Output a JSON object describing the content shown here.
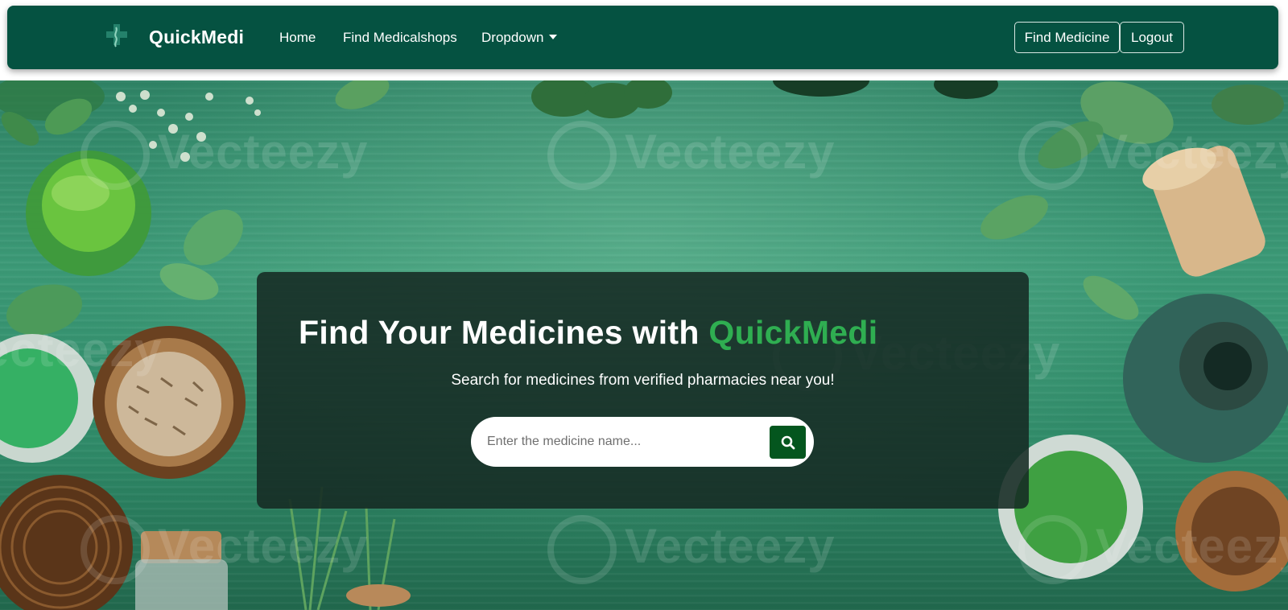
{
  "navbar": {
    "brand": "QuickMedi",
    "brand_icon": "medical-cross-icon",
    "links": {
      "home": "Home",
      "shops": "Find Medicalshops",
      "dropdown": "Dropdown"
    },
    "buttons": {
      "find_medicine": "Find Medicine",
      "logout": "Logout"
    },
    "background_color": "#055241"
  },
  "hero": {
    "title_prefix": "Find Your Medicines with ",
    "title_accent": "QuickMedi",
    "accent_color": "#2fae51",
    "subtitle": "Search for medicines from verified pharmacies near you!",
    "search": {
      "placeholder": "Enter the medicine name...",
      "value": "",
      "button_icon": "search-icon",
      "button_color": "#04561e"
    },
    "watermark": "Vecteezy"
  }
}
